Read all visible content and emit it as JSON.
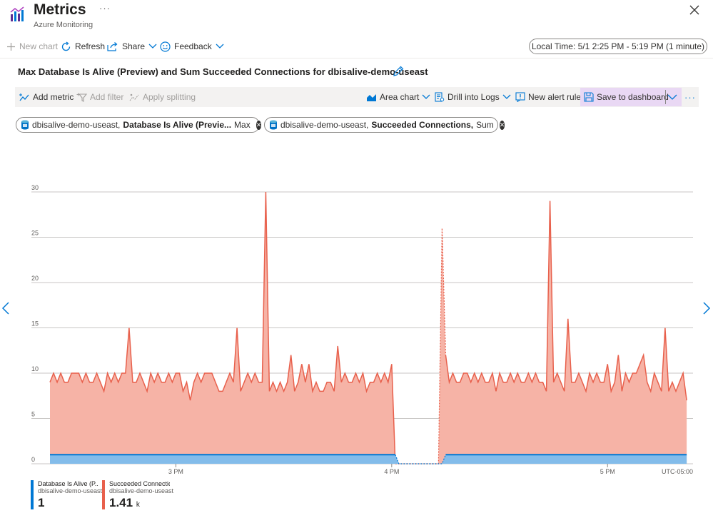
{
  "header": {
    "title": "Metrics",
    "subtitle": "Azure Monitoring",
    "more": "···"
  },
  "commands": {
    "new_chart": "New chart",
    "refresh": "Refresh",
    "share": "Share",
    "feedback": "Feedback",
    "time_range": "Local Time: 5/1 2:25 PM - 5:19 PM (1 minute)"
  },
  "chart_title": "Max Database Is Alive (Preview) and Sum Succeeded Connections for dbisalive-demo-useast",
  "toolbar": {
    "add_metric": "Add metric",
    "add_filter": "Add filter",
    "apply_splitting": "Apply splitting",
    "area_chart": "Area chart",
    "drill_into_logs": "Drill into Logs",
    "new_alert_rule": "New alert rule",
    "save_to_dashboard": "Save to dashboard",
    "more": "···"
  },
  "pills": [
    {
      "resource": "dbisalive-demo-useast,",
      "metric": "Database Is Alive (Previe...",
      "agg": "Max"
    },
    {
      "resource": "dbisalive-demo-useast,",
      "metric": "Succeeded Connections,",
      "agg": "Sum"
    }
  ],
  "legend": [
    {
      "name": "Database Is Alive (P...",
      "resource": "dbisalive-demo-useast",
      "value": "1",
      "unit": "",
      "color": "#0078d4"
    },
    {
      "name": "Succeeded Connection...",
      "resource": "dbisalive-demo-useast",
      "value": "1.41",
      "unit": "k",
      "color": "#e8604c"
    }
  ],
  "chart_data": {
    "type": "area",
    "y_ticks": [
      "0",
      "5",
      "10",
      "15",
      "20",
      "25",
      "30"
    ],
    "ylim": [
      0,
      30
    ],
    "x_ticks": [
      {
        "label": "3 PM",
        "t": 35
      },
      {
        "label": "4 PM",
        "t": 95
      },
      {
        "label": "5 PM",
        "t": 155
      }
    ],
    "xlim": [
      0,
      174
    ],
    "timezone": "UTC-05:00",
    "grid": true,
    "gap": [
      97,
      109
    ],
    "series": [
      {
        "name": "Succeeded Connections",
        "color": "#e8604c",
        "fill": "#f6b3a6",
        "values": [
          9,
          10,
          9,
          10,
          9,
          9,
          10,
          10,
          10,
          9,
          10,
          9,
          9,
          10,
          9,
          8,
          10,
          9,
          10,
          9,
          10,
          10,
          15,
          9,
          9,
          10,
          9,
          8,
          10,
          9,
          10,
          9,
          9,
          10,
          9,
          10,
          10,
          8,
          9,
          7,
          9,
          10,
          9,
          10,
          10,
          10,
          9,
          8,
          8,
          9,
          10,
          9,
          15,
          8,
          9,
          10,
          9,
          10,
          9,
          9,
          30,
          8,
          9,
          8,
          9,
          8,
          9,
          12,
          8,
          9,
          11,
          9,
          11,
          8,
          9,
          8,
          8,
          9,
          9,
          8,
          13,
          9,
          10,
          9,
          9,
          10,
          9,
          10,
          8,
          9,
          9,
          10,
          9,
          10,
          9,
          11,
          0,
          0,
          0,
          0,
          0,
          0,
          0,
          0,
          0,
          0,
          0,
          0,
          0,
          26,
          12,
          9,
          10,
          9,
          9,
          10,
          10,
          9,
          10,
          9,
          10,
          9,
          9,
          10,
          8,
          10,
          9,
          9,
          10,
          9,
          10,
          9,
          9,
          10,
          9,
          10,
          9,
          9,
          8,
          29,
          9,
          10,
          9,
          8,
          16,
          9,
          9,
          10,
          9,
          8,
          10,
          9,
          10,
          9,
          9,
          11,
          8,
          9,
          12,
          8,
          10,
          9,
          10,
          10,
          11,
          12,
          9,
          8,
          10,
          9,
          8,
          15,
          8,
          9,
          8,
          9,
          10,
          7
        ],
        "gap": [
          97,
          109
        ]
      },
      {
        "name": "Database Is Alive",
        "color": "#0078d4",
        "fill": "#83bcea",
        "value": 1,
        "gap": [
          97,
          109
        ]
      }
    ]
  }
}
